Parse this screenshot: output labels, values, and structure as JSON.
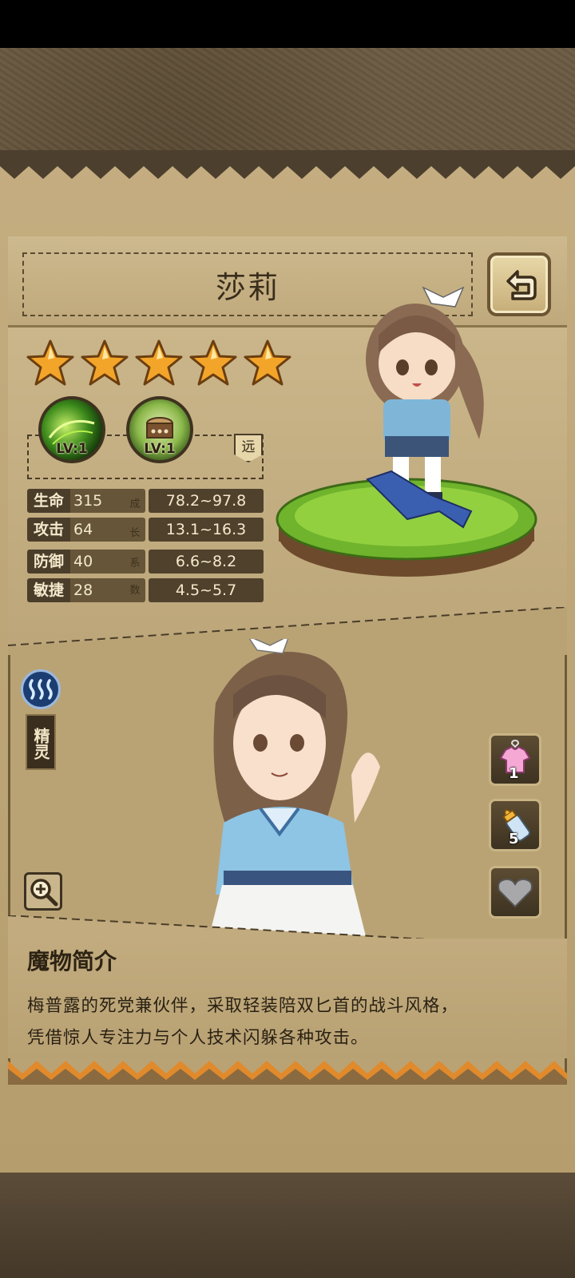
{
  "character": {
    "name": "莎莉",
    "stars": 5,
    "element_tag": "精灵"
  },
  "skills": [
    {
      "level": "LV:1",
      "icon": "green-swirl-skill-icon"
    },
    {
      "level": "LV:1",
      "icon": "drum-bag-skill-icon"
    }
  ],
  "range_tag": "远",
  "stats": [
    {
      "label": "生命",
      "value": "315",
      "growth": "78.2~97.8"
    },
    {
      "label": "攻击",
      "value": "64",
      "growth": "13.1~16.3"
    },
    {
      "label": "防御",
      "value": "40",
      "growth": "6.6~8.2"
    },
    {
      "label": "敏捷",
      "value": "28",
      "growth": "4.5~5.7"
    }
  ],
  "growth_label": [
    "成",
    "长",
    "系",
    "数"
  ],
  "side_buttons": [
    {
      "icon": "outfit-icon",
      "badge": "1"
    },
    {
      "icon": "bottle-icon",
      "badge": "5"
    },
    {
      "icon": "heart-icon",
      "badge": ""
    }
  ],
  "description": {
    "title": "魔物简介",
    "lines": [
      "梅普露的死党兼伙伴，采取轻装陪双匕首的战斗风格，",
      "凭借惊人专注力与个人技术闪躲各种攻击。"
    ]
  },
  "colors": {
    "parchment": "#c4ad80",
    "dark_label": "#4a3d2a",
    "star": "#f3a52a"
  }
}
